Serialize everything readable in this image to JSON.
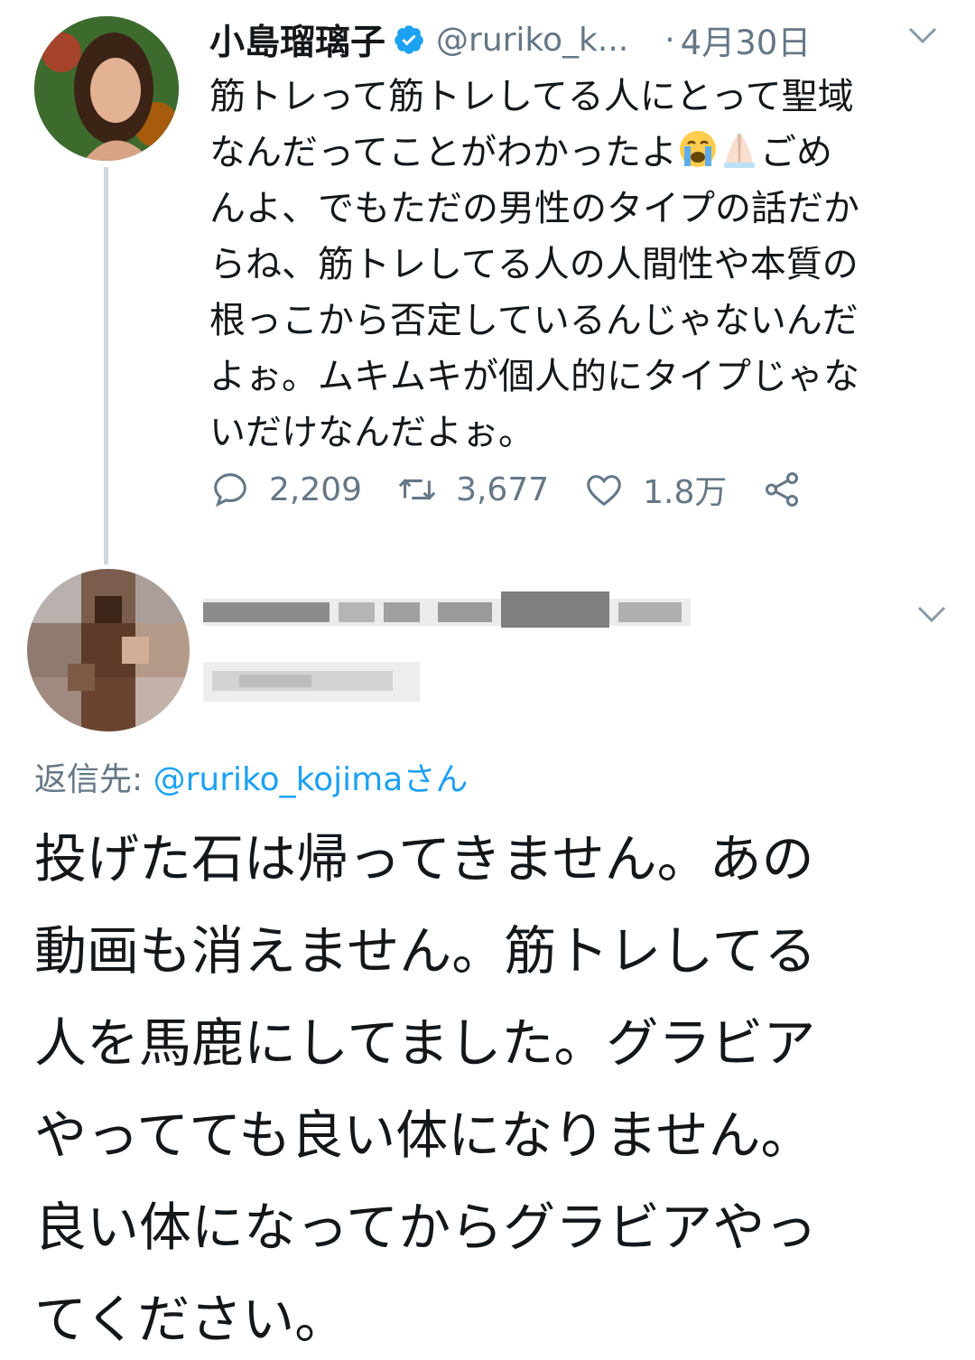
{
  "tweet": {
    "author_name": "小島瑠璃子",
    "verified": true,
    "handle": "@ruriko_k...",
    "separator": "·",
    "date": "4月30日",
    "text_lines": [
      "筋トレって筋トレしてる人にとって聖域",
      "なんだってことがわかったよ",
      "ごめ",
      "んよ、でもただの男性のタイプの話だか",
      "らね、筋トレしてる人の人間性や本質の",
      "根っこから否定しているんじゃないんだ",
      "よぉ。ムキムキが個人的にタイプじゃな",
      "いだけなんだよぉ。"
    ],
    "emoji": [
      "crying-face",
      "folded-hands"
    ],
    "actions": {
      "replies": "2,209",
      "retweets": "3,677",
      "likes": "1.8万"
    }
  },
  "reply": {
    "author_obscured": true,
    "reply_to_label": "返信先: ",
    "reply_to_handle": "@ruriko_kojima",
    "reply_to_suffix": "さん",
    "text_lines": [
      "投げた石は帰ってきません。あの",
      "動画も消えません。筋トレしてる",
      "人を馬鹿にしてました。グラビア",
      "やってても良い体になりません。",
      "良い体になってからグラビアやっ",
      "てください。"
    ]
  },
  "colors": {
    "text": "#14171a",
    "secondary": "#657786",
    "link": "#1da1f2",
    "verified": "#1da1f2",
    "thread_line": "#ccd6dd"
  }
}
